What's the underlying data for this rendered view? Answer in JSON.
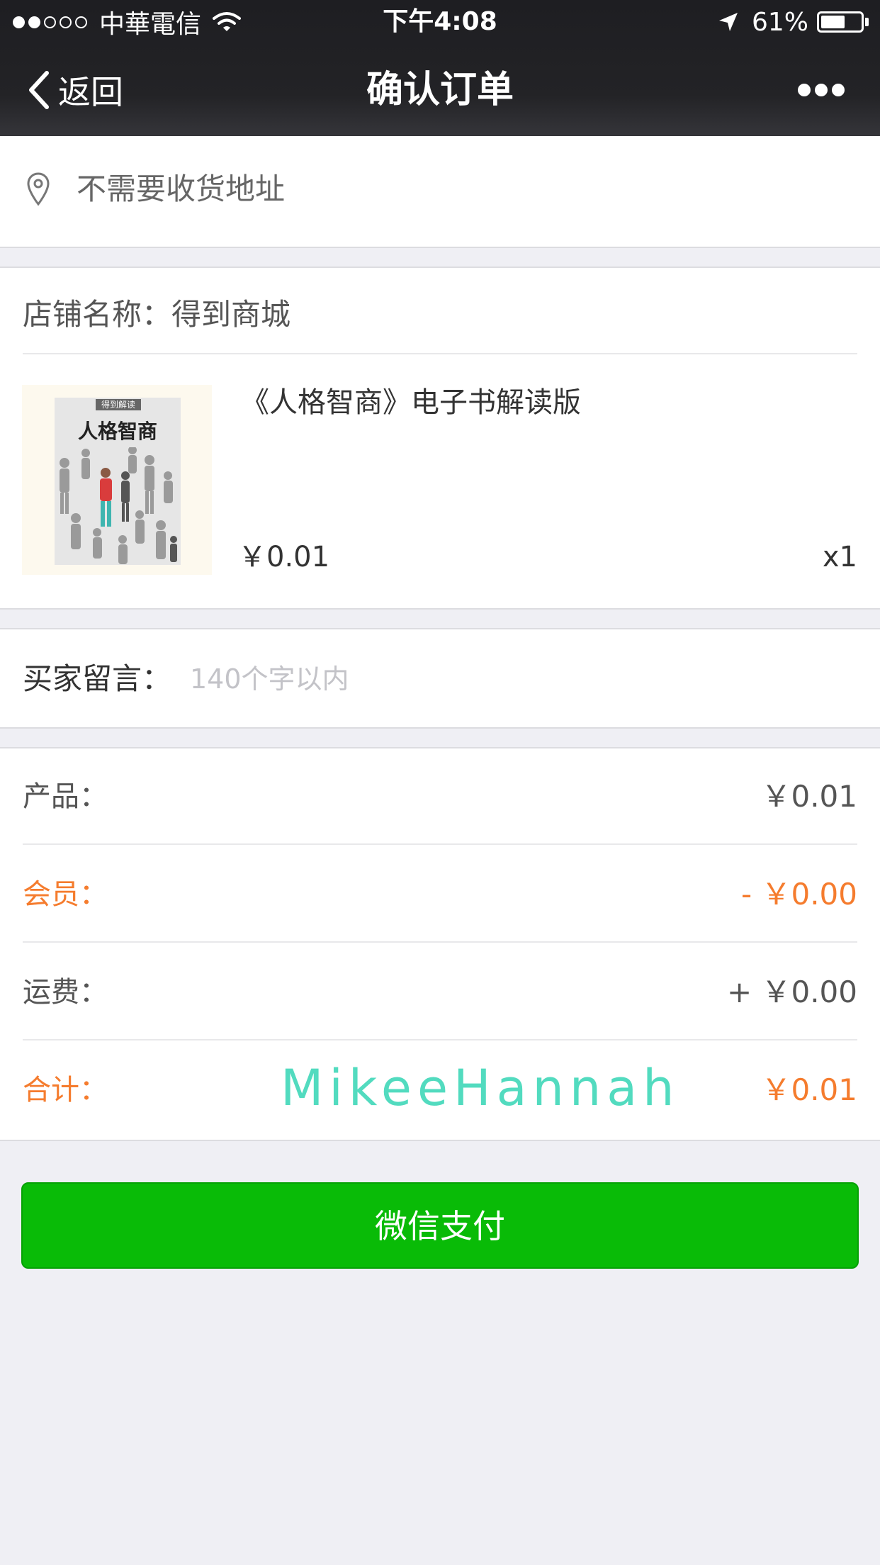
{
  "status_bar": {
    "carrier": "中華電信",
    "time": "下午4:08",
    "battery": "61%",
    "battery_level": 0.61,
    "signal_bars_filled": 2,
    "signal_bars_total": 5
  },
  "nav": {
    "back_label": "返回",
    "title": "确认订单"
  },
  "address": {
    "text": "不需要收货地址"
  },
  "shop": {
    "name": "店铺名称：得到商城",
    "product": {
      "title": "《人格智商》电子书解读版",
      "price": "￥0.01",
      "quantity": "x1",
      "cover_tag": "得到解读",
      "cover_title": "人格智商"
    }
  },
  "message": {
    "label": "买家留言：",
    "placeholder": "140个字以内",
    "value": ""
  },
  "summary": {
    "rows": [
      {
        "label": "产品：",
        "value": "￥0.01"
      },
      {
        "label": "会员：",
        "value": "- ￥0.00"
      },
      {
        "label": "运费：",
        "value": "+ ￥0.00"
      },
      {
        "label": "合计：",
        "value": "￥0.01"
      }
    ],
    "watermark": "MikeeHannah"
  },
  "pay_button": {
    "label": "微信支付"
  },
  "colors": {
    "accent_orange": "#f57c2e",
    "pay_green": "#09bb07",
    "watermark_teal": "#52dbbf"
  }
}
